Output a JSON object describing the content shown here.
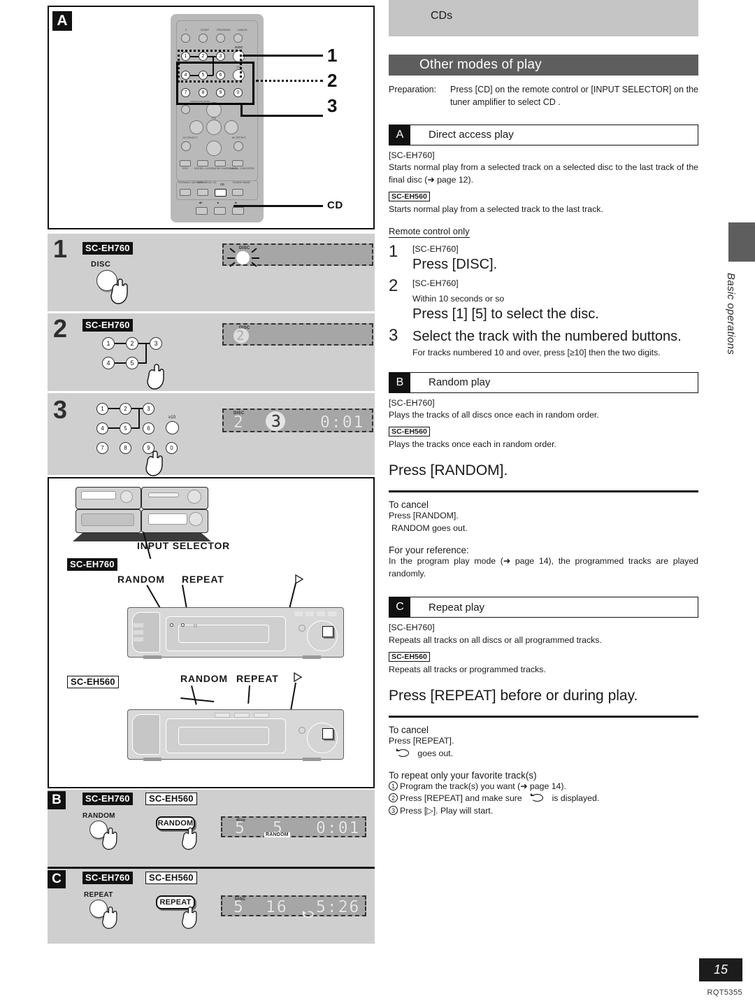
{
  "page": {
    "number": "15",
    "doc_code": "RQT5355",
    "side_tab_label": "Basic operations"
  },
  "right": {
    "breadcrumb_band": "CDs",
    "section_title": "Other modes of play",
    "preparation": {
      "label": "Preparation:",
      "text": "Press [CD] on the remote control or [INPUT SELECTOR] on the tuner amplifier to select  CD ."
    },
    "sections": [
      {
        "letter": "A",
        "title": "Direct access play",
        "model_760_tag": "[SC-EH760]",
        "model_760_text": "Starts normal play from a selected track on a selected disc to the last track of the final disc (➜ page 12).",
        "model_560_tag": "SC-EH560",
        "model_560_text": "Starts normal play from a selected track to the last track.",
        "remote_only": "Remote control only",
        "steps": [
          {
            "n": "1",
            "model": "[SC-EH760]",
            "instruction": "Press [DISC]."
          },
          {
            "n": "2",
            "model": "[SC-EH760]",
            "pre": "Within 10 seconds or so",
            "instruction": "Press [1] [5] to select the disc."
          },
          {
            "n": "3",
            "instruction": "Select the track with the numbered buttons.",
            "note": "For tracks numbered 10 and over, press [≥10] then the two digits."
          }
        ]
      },
      {
        "letter": "B",
        "title": "Random play",
        "model_760_tag": "[SC-EH760]",
        "model_760_text": "Plays the tracks of all discs once each in random order.",
        "model_560_tag": "SC-EH560",
        "model_560_text": "Plays the tracks once each in random order.",
        "press": "Press [RANDOM].",
        "cancel_head": "To cancel",
        "cancel_line1": "Press [RANDOM].",
        "cancel_line2": "RANDOM  goes out.",
        "reference_head": "For your reference:",
        "reference_body": "In the program play mode (➜ page 14), the programmed tracks are played randomly."
      },
      {
        "letter": "C",
        "title": "Repeat play",
        "model_760_tag": "[SC-EH760]",
        "model_760_text": "Repeats all tracks on all discs or all programmed tracks.",
        "model_560_tag": "SC-EH560",
        "model_560_text": "Repeats all tracks or programmed tracks.",
        "press": "Press [REPEAT] before or during play.",
        "cancel_head": "To cancel",
        "cancel_line1": "Press [REPEAT].",
        "cancel_line2": "goes out.",
        "favorite_head": "To repeat only your favorite track(s)",
        "favorite_items": [
          "Program the track(s) you want (➜ page 14).",
          "Press [REPEAT] and make sure",
          "Press [▷]. Play will start."
        ],
        "favorite_item2_tail": "is displayed."
      }
    ]
  },
  "left": {
    "figure_a_badge": "A",
    "remote": {
      "top_labels": [
        "II",
        "SLEEP",
        "PROGRAM",
        "CANCEL"
      ],
      "disc_label": "DISC",
      "ten_label": "≥10",
      "number_keys": [
        "1",
        "2",
        "3",
        "4",
        "5",
        "6",
        "7",
        "8",
        "9",
        "0"
      ],
      "mid_labels": [
        "CH SELECT",
        "AV EFFECT"
      ],
      "eq_label": "EQ",
      "mode_labels": [
        "TEST",
        "DOPRO LOGIC",
        "SUPER SURROUND",
        "DIGITAL S.WOOFER"
      ],
      "source_labels": [
        "VCR/AUX/ NCH INPUT",
        "TAPE/ DECK 1/2",
        "CD",
        "TUNER/ BAND"
      ],
      "transport_labels": [
        "◀II",
        "■",
        "▶"
      ],
      "callouts": [
        "1",
        "2",
        "3"
      ],
      "cd_callout": "CD"
    },
    "steps": [
      {
        "num": "1",
        "model_tag": "SC-EH760",
        "button_label": "DISC",
        "display": {
          "disc_label": "DISC",
          "digits": "",
          "blinking": true
        }
      },
      {
        "num": "2",
        "model_tag": "SC-EH760",
        "keys": [
          "1",
          "2",
          "3",
          "4",
          "5"
        ],
        "display": {
          "disc_label": "DISC",
          "digits": "2",
          "blinking": true
        }
      },
      {
        "num": "3",
        "keys": [
          "1",
          "2",
          "3",
          "4",
          "5",
          "6",
          "7",
          "8",
          "9",
          "0"
        ],
        "ten_label": "≥10",
        "display": {
          "disc_label": "DISC",
          "disc_no": "2",
          "track_no": "3",
          "time": "0:01"
        }
      }
    ],
    "system": {
      "input_selector_label": "INPUT SELECTOR",
      "model_760_tag": "SC-EH760",
      "model_560_tag": "SC-EH560",
      "labels_760": [
        "RANDOM",
        "REPEAT"
      ],
      "labels_560": [
        "RANDOM",
        "REPEAT"
      ]
    },
    "panel_b": {
      "badge": "B",
      "tag_760": "SC-EH760",
      "tag_560": "SC-EH560",
      "button_760": "RANDOM",
      "button_560": "RANDOM",
      "display": {
        "disc_label": "disc",
        "disc_no": "5",
        "track_no": "5",
        "time": "0:01",
        "indicator": "RANDOM"
      }
    },
    "panel_c": {
      "badge": "C",
      "tag_760": "SC-EH760",
      "tag_560": "SC-EH560",
      "button_760": "REPEAT",
      "button_560": "REPEAT",
      "display": {
        "disc_label": "DISC",
        "disc_no": "5",
        "track_no": "16",
        "time": "5:26",
        "indicator": "repeat"
      }
    }
  }
}
